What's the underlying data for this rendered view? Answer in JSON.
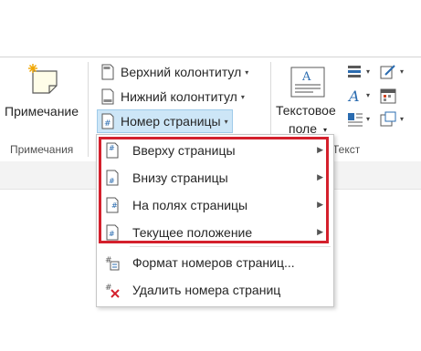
{
  "ribbon": {
    "comment_button": "Примечание",
    "comments_group": "Примечания",
    "header": "Верхний колонтитул",
    "footer": "Нижний колонтитул",
    "page_number": "Номер страницы",
    "textbox_line1": "Текстовое",
    "textbox_line2": "поле",
    "text_group": "Текст"
  },
  "menu": {
    "items": [
      {
        "label": "Вверху страницы",
        "has_submenu": true
      },
      {
        "label": "Внизу страницы",
        "has_submenu": true
      },
      {
        "label": "На полях страницы",
        "has_submenu": true
      },
      {
        "label": "Текущее положение",
        "has_submenu": true
      }
    ],
    "actions": [
      {
        "label": "Формат номеров страниц..."
      },
      {
        "label": "Удалить номера страниц"
      }
    ]
  },
  "colors": {
    "highlight": "#d4202c",
    "active_button": "#cde6f7",
    "accent_blue": "#2b6cb0"
  },
  "icons": {
    "comment": "new-comment-icon",
    "header": "header-icon",
    "footer": "footer-icon",
    "page_number": "page-number-icon",
    "textbox": "textbox-icon",
    "format": "format-page-numbers-icon",
    "remove": "remove-page-numbers-icon"
  }
}
